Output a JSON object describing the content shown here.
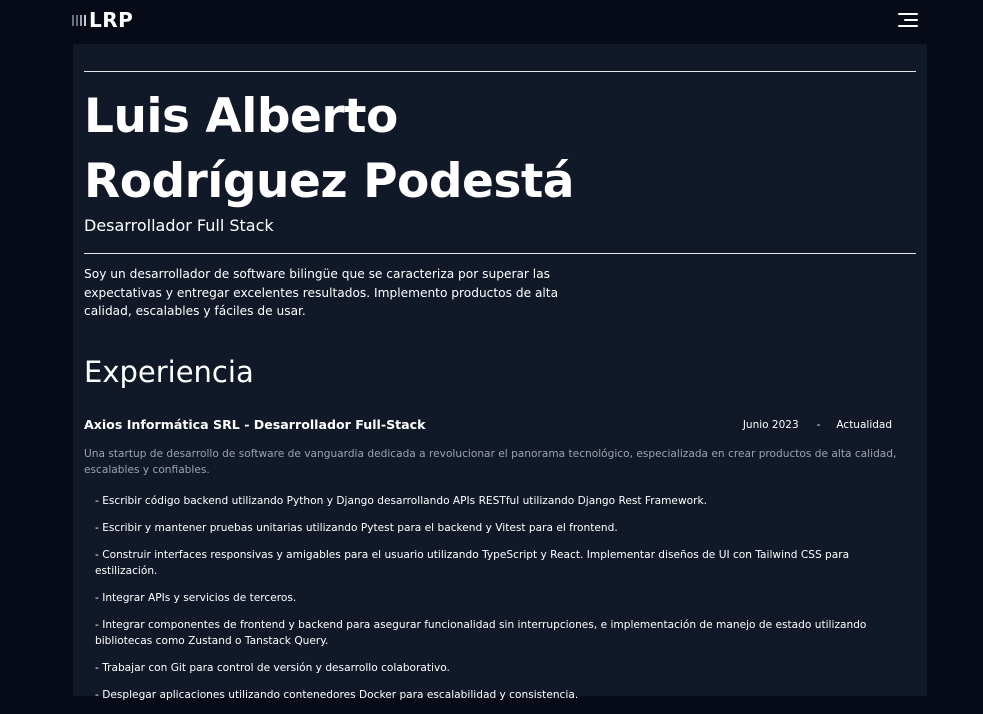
{
  "header": {
    "logo_text": "LRP",
    "menu_icon": "hamburger-menu-icon"
  },
  "profile": {
    "name_line1": "Luis Alberto",
    "name_line2": "Rodríguez Podestá",
    "role": "Desarrollador Full Stack",
    "summary": "Soy un desarrollador de software bilingüe que se caracteriza por superar las expectativas y entregar excelentes resultados. Implemento productos de alta calidad, escalables y fáciles de usar."
  },
  "experience": {
    "title": "Experiencia",
    "jobs": [
      {
        "title": "Axios Informática SRL - Desarrollador Full-Stack",
        "start": "Junio 2023",
        "separator": "-",
        "end": "Actualidad",
        "description": "Una startup de desarrollo de software de vanguardia dedicada a revolucionar el panorama tecnológico, especializada en crear productos de alta calidad, escalables y confiables.",
        "duties": [
          "- Escribir código backend utilizando Python y Django desarrollando APIs RESTful utilizando Django Rest Framework.",
          "- Escribir y mantener pruebas unitarias utilizando Pytest para el backend y Vitest para el frontend.",
          "- Construir interfaces responsivas y amigables para el usuario utilizando TypeScript y React. Implementar diseños de UI con Tailwind CSS para estilización.",
          "- Integrar APIs y servicios de terceros.",
          "- Integrar componentes de frontend y backend para asegurar funcionalidad sin interrupciones, e implementación de manejo de estado utilizando bibliotecas como Zustand o Tanstack Query.",
          "- Trabajar con Git para control de versión y desarrollo colaborativo.",
          "- Desplegar aplicaciones utilizando contenedores Docker para escalabilidad y consistencia."
        ]
      }
    ]
  },
  "colors": {
    "page_background": "#070b18",
    "panel_background": "#111827",
    "text": "#ffffff",
    "muted_text": "#9ca3af"
  }
}
